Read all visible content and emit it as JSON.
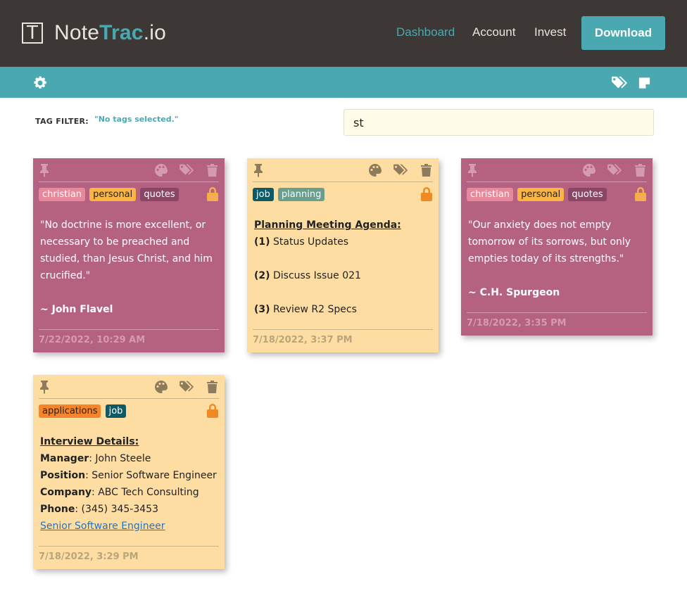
{
  "header": {
    "logo_letter": "T",
    "logo_part1": "Note",
    "logo_part2": "Trac",
    "logo_part3": ".io",
    "nav": [
      "Dashboard",
      "Account",
      "Invest"
    ],
    "download_label": "Download"
  },
  "toolbar": {
    "left_icon": "gear-icon",
    "right_icons": [
      "tags-icon",
      "note-icon"
    ]
  },
  "filter": {
    "label": "TAG FILTER:",
    "value": "\"No tags selected.\"",
    "search_value": "st"
  },
  "colors": {
    "header_bg": "#3d3836",
    "accent": "#4aa9b0",
    "note_purple": "#b56182",
    "note_yellow": "#fedda2"
  },
  "notes": [
    {
      "color": "purple",
      "tags": [
        {
          "label": "christian",
          "bg": "#e7889b",
          "fg": "#ffffff"
        },
        {
          "label": "personal",
          "bg": "#fcb542",
          "fg": "#222222"
        },
        {
          "label": "quotes",
          "bg": "#8a4765",
          "fg": "#ffffff"
        }
      ],
      "lines": [
        "\"No doctrine is more excellent, or",
        "necessary to be preached and",
        "studied, than Jesus Christ, and him",
        "crucified.\"",
        "",
        "~ John Flavel"
      ],
      "date": "7/22/2022, 10:29 AM"
    },
    {
      "color": "yellow",
      "tags": [
        {
          "label": "job",
          "bg": "#0d5a66",
          "fg": "#ffffff"
        },
        {
          "label": "planning",
          "bg": "#6a9e8e",
          "fg": "#ffffff"
        }
      ],
      "title": "Planning Meeting Agenda:",
      "items": [
        {
          "num": "(1)",
          "text": " Status Updates"
        },
        {
          "num": "(2)",
          "text": " Discuss Issue 021"
        },
        {
          "num": "(3)",
          "text": " Review R2 Specs"
        }
      ],
      "date": "7/18/2022, 3:37 PM"
    },
    {
      "color": "purple",
      "tags": [
        {
          "label": "christian",
          "bg": "#e7889b",
          "fg": "#ffffff"
        },
        {
          "label": "personal",
          "bg": "#fcb542",
          "fg": "#222222"
        },
        {
          "label": "quotes",
          "bg": "#8a4765",
          "fg": "#ffffff"
        }
      ],
      "lines": [
        "\"Our anxiety does not empty",
        "tomorrow of its sorrows, but only",
        "empties today of its strengths.\"",
        "",
        "~ C.H. Spurgeon"
      ],
      "date": "7/18/2022, 3:35 PM"
    },
    {
      "color": "yellow",
      "tags": [
        {
          "label": "applications",
          "bg": "#f5842a",
          "fg": "#222222"
        },
        {
          "label": "job",
          "bg": "#0d5a66",
          "fg": "#ffffff"
        }
      ],
      "title": "Interview Details:",
      "fields": [
        {
          "key": "Manager",
          "value": ": John Steele"
        },
        {
          "key": "Position",
          "value": ": Senior Software Engineer"
        },
        {
          "key": "Company",
          "value": ": ABC Tech Consulting"
        },
        {
          "key": "Phone",
          "value": ": (345) 345-3453"
        }
      ],
      "link": "Senior Software Engineer",
      "date": "7/18/2022, 3:29 PM"
    }
  ]
}
